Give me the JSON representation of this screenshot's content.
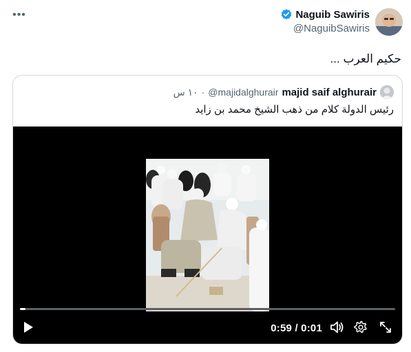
{
  "tweet": {
    "author_name": "Naguib Sawiris",
    "author_handle": "@NaguibSawiris",
    "text": "حكيم العرب ...",
    "more_icon": "ellipsis-icon",
    "verified_color": "#1d9bf0"
  },
  "quote": {
    "author_name": "majid saif alghurair",
    "author_handle": "@majidalghurair",
    "separator": "·",
    "time": "١٠ س",
    "text": "رئيس الدولة كلام من ذهب الشيخ محمد بن زايد"
  },
  "video": {
    "current_time": "0:59",
    "time_separator": "/",
    "duration": "0:01",
    "time_display": "0:59 / 0:01",
    "progress": 0.015,
    "controls": [
      "play-icon",
      "volume-icon",
      "settings-icon",
      "fullscreen-icon"
    ]
  }
}
